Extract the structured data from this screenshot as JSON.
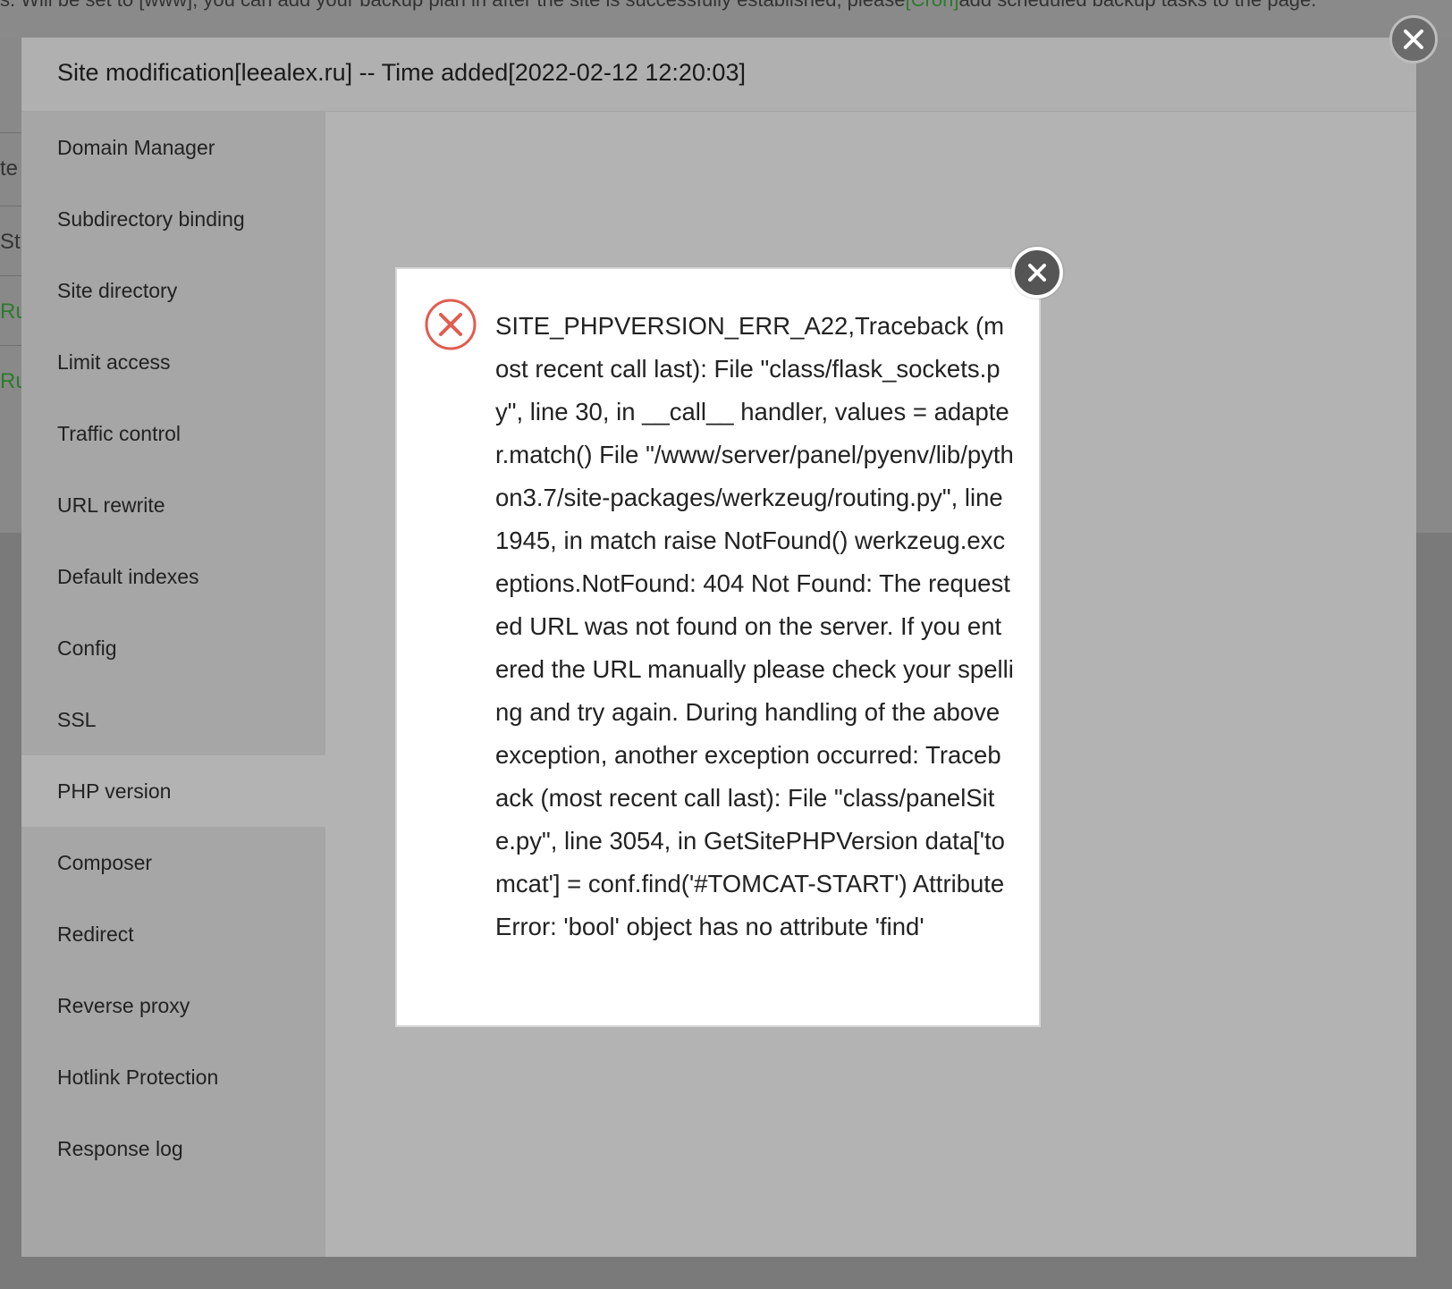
{
  "background": {
    "notice": "s. Will be set to [www], you can add your backup plan in after the site is successfully established, please",
    "notice_link": "[Cron]",
    "notice_tail": "add scheduled backup tasks to the page.",
    "rows": [
      "te",
      "St",
      "Ru",
      "Ru"
    ]
  },
  "modal": {
    "title": "Site modification[leealex.ru] -- Time added[2022-02-12 12:20:03]",
    "close_label": "close",
    "sidebar": [
      {
        "label": "Domain Manager",
        "active": false
      },
      {
        "label": "Subdirectory binding",
        "active": false
      },
      {
        "label": "Site directory",
        "active": false
      },
      {
        "label": "Limit access",
        "active": false
      },
      {
        "label": "Traffic control",
        "active": false
      },
      {
        "label": "URL rewrite",
        "active": false
      },
      {
        "label": "Default indexes",
        "active": false
      },
      {
        "label": "Config",
        "active": false
      },
      {
        "label": "SSL",
        "active": false
      },
      {
        "label": "PHP version",
        "active": true
      },
      {
        "label": "Composer",
        "active": false
      },
      {
        "label": "Redirect",
        "active": false
      },
      {
        "label": "Reverse proxy",
        "active": false
      },
      {
        "label": "Hotlink Protection",
        "active": false
      },
      {
        "label": "Response log",
        "active": false
      }
    ]
  },
  "error_dialog": {
    "icon": "error-x-circle-icon",
    "icon_color": "#e25c4f",
    "message": "SITE_PHPVERSION_ERR_A22,Traceback (most recent call last): File \"class/flask_sockets.py\", line 30, in __call__ handler, values = adapter.match() File \"/www/server/panel/pyenv/lib/python3.7/site-packages/werkzeug/routing.py\", line 1945, in match raise NotFound() werkzeug.exceptions.NotFound: 404 Not Found: The requested URL was not found on the server. If you entered the URL manually please check your spelling and try again. During handling of the above exception, another exception occurred: Traceback (most recent call last): File \"class/panelSite.py\", line 3054, in GetSitePHPVersion data['tomcat'] = conf.find('#TOMCAT-START') AttributeError: 'bool' object has no attribute 'find'"
  }
}
